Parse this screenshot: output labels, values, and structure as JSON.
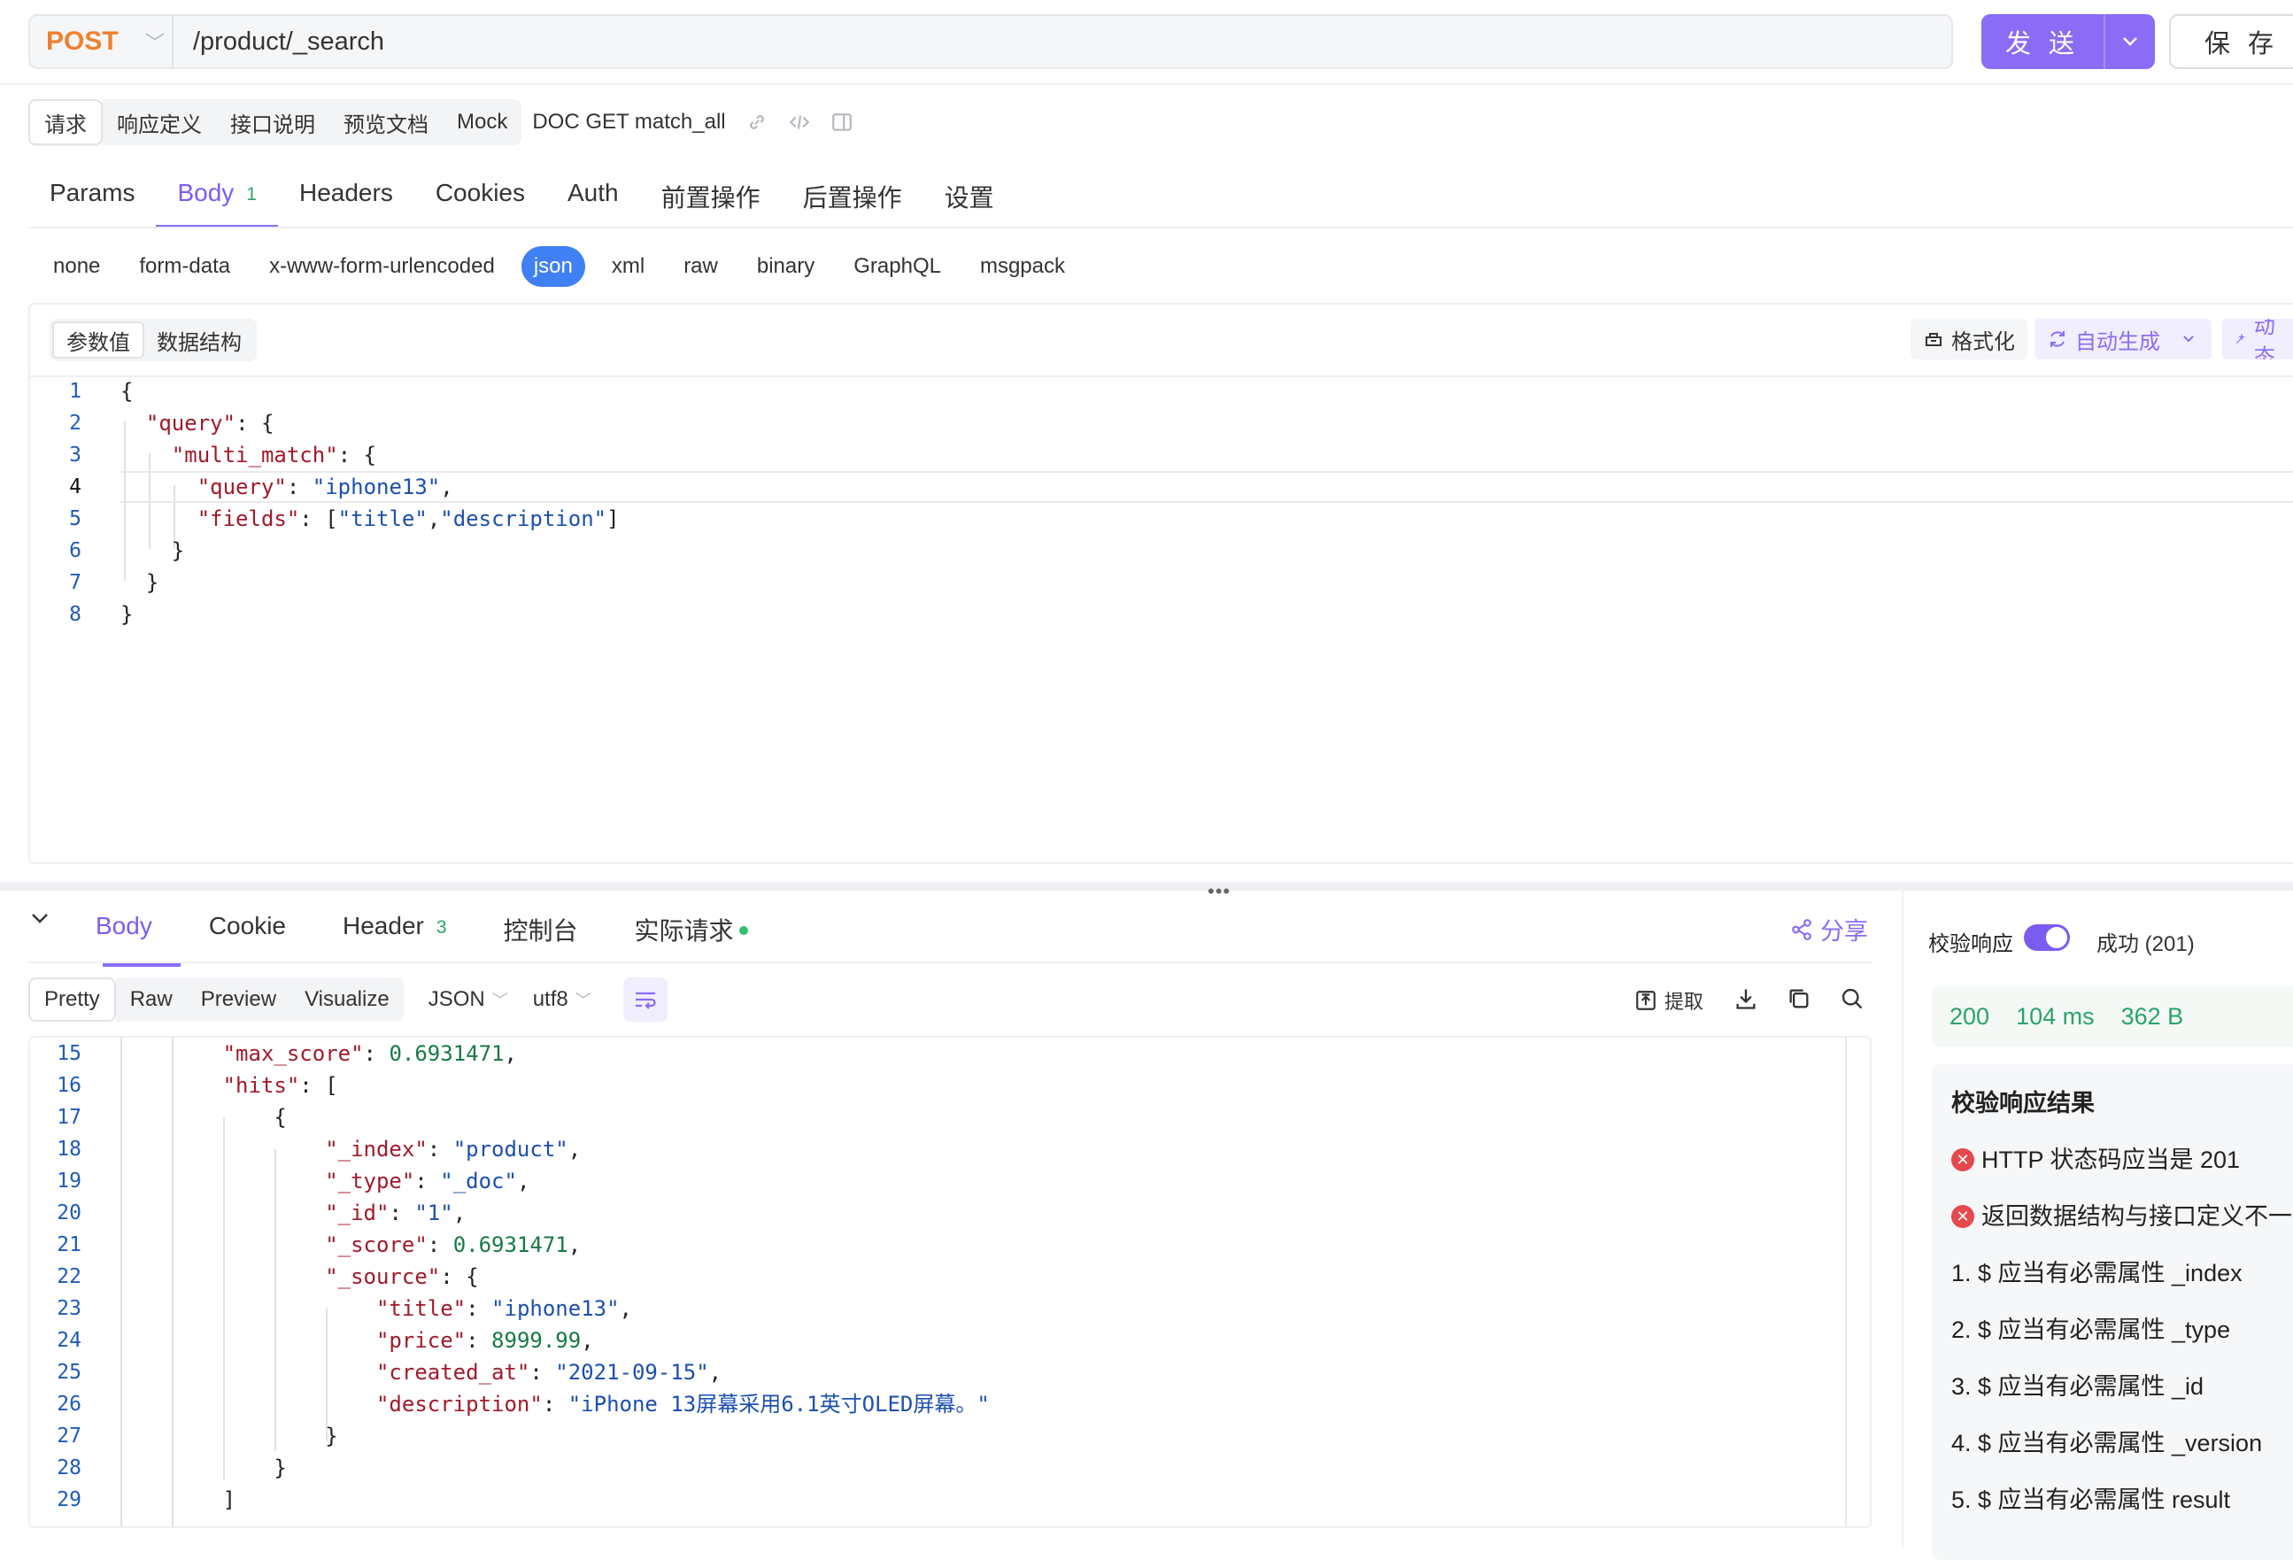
{
  "url_bar": {
    "method": "POST",
    "url": "/product/_search",
    "send_label": "发 送",
    "save_label": "保 存"
  },
  "sub_tabs": [
    "请求",
    "响应定义",
    "接口说明",
    "预览文档",
    "Mock"
  ],
  "doc_name": "DOC GET match_all",
  "main_tabs": [
    {
      "label": "Params"
    },
    {
      "label": "Body",
      "badge": "1"
    },
    {
      "label": "Headers"
    },
    {
      "label": "Cookies"
    },
    {
      "label": "Auth"
    },
    {
      "label": "前置操作"
    },
    {
      "label": "后置操作"
    },
    {
      "label": "设置"
    }
  ],
  "body_types": [
    "none",
    "form-data",
    "x-www-form-urlencoded",
    "json",
    "xml",
    "raw",
    "binary",
    "GraphQL",
    "msgpack"
  ],
  "active_body_type": "json",
  "param_toggle": [
    "参数值",
    "数据结构"
  ],
  "editor_tools": {
    "format": "格式化",
    "auto_gen": "自动生成",
    "dynamic": "动态"
  },
  "request_body_lines": [
    {
      "n": "1",
      "text": "{"
    },
    {
      "n": "2",
      "text": "  \"query\": {"
    },
    {
      "n": "3",
      "text": "    \"multi_match\": {"
    },
    {
      "n": "4",
      "text": "      \"query\": \"iphone13\","
    },
    {
      "n": "5",
      "text": "      \"fields\": [\"title\",\"description\"]"
    },
    {
      "n": "6",
      "text": "    }"
    },
    {
      "n": "7",
      "text": "  }"
    },
    {
      "n": "8",
      "text": "}"
    }
  ],
  "response_tabs": [
    {
      "label": "Body"
    },
    {
      "label": "Cookie"
    },
    {
      "label": "Header",
      "badge": "3"
    },
    {
      "label": "控制台"
    },
    {
      "label": "实际请求"
    }
  ],
  "share_label": "分享",
  "view_modes": [
    "Pretty",
    "Raw",
    "Preview",
    "Visualize"
  ],
  "format_select": "JSON",
  "encoding_select": "utf8",
  "extract_label": "提取",
  "response_lines": [
    {
      "n": "15",
      "text": "        \"max_score\": 0.6931471,"
    },
    {
      "n": "16",
      "text": "        \"hits\": ["
    },
    {
      "n": "17",
      "text": "            {"
    },
    {
      "n": "18",
      "text": "                \"_index\": \"product\","
    },
    {
      "n": "19",
      "text": "                \"_type\": \"_doc\","
    },
    {
      "n": "20",
      "text": "                \"_id\": \"1\","
    },
    {
      "n": "21",
      "text": "                \"_score\": 0.6931471,"
    },
    {
      "n": "22",
      "text": "                \"_source\": {"
    },
    {
      "n": "23",
      "text": "                    \"title\": \"iphone13\","
    },
    {
      "n": "24",
      "text": "                    \"price\": 8999.99,"
    },
    {
      "n": "25",
      "text": "                    \"created_at\": \"2021-09-15\","
    },
    {
      "n": "26",
      "text": "                    \"description\": \"iPhone 13屏幕采用6.1英寸OLED屏幕。\""
    },
    {
      "n": "27",
      "text": "                }"
    },
    {
      "n": "28",
      "text": "            }"
    },
    {
      "n": "29",
      "text": "        ]"
    }
  ],
  "validation": {
    "label": "校验响应",
    "enabled": true,
    "status_text": "成功 (201)",
    "status_code": "200",
    "time": "104 ms",
    "size": "362 B",
    "result_title": "校验响应结果",
    "errors": [
      "HTTP 状态码应当是 201",
      "返回数据结构与接口定义不一"
    ],
    "items": [
      "1. $ 应当有必需属性 _index",
      "2. $ 应当有必需属性 _type",
      "3. $ 应当有必需属性 _id",
      "4. $ 应当有必需属性 _version",
      "5. $ 应当有必需属性 result"
    ]
  },
  "colors": {
    "accent": "#8a6cf6",
    "method": "#f0802f",
    "active_type": "#4080f5",
    "success": "#29a36a",
    "error": "#e5484d"
  }
}
